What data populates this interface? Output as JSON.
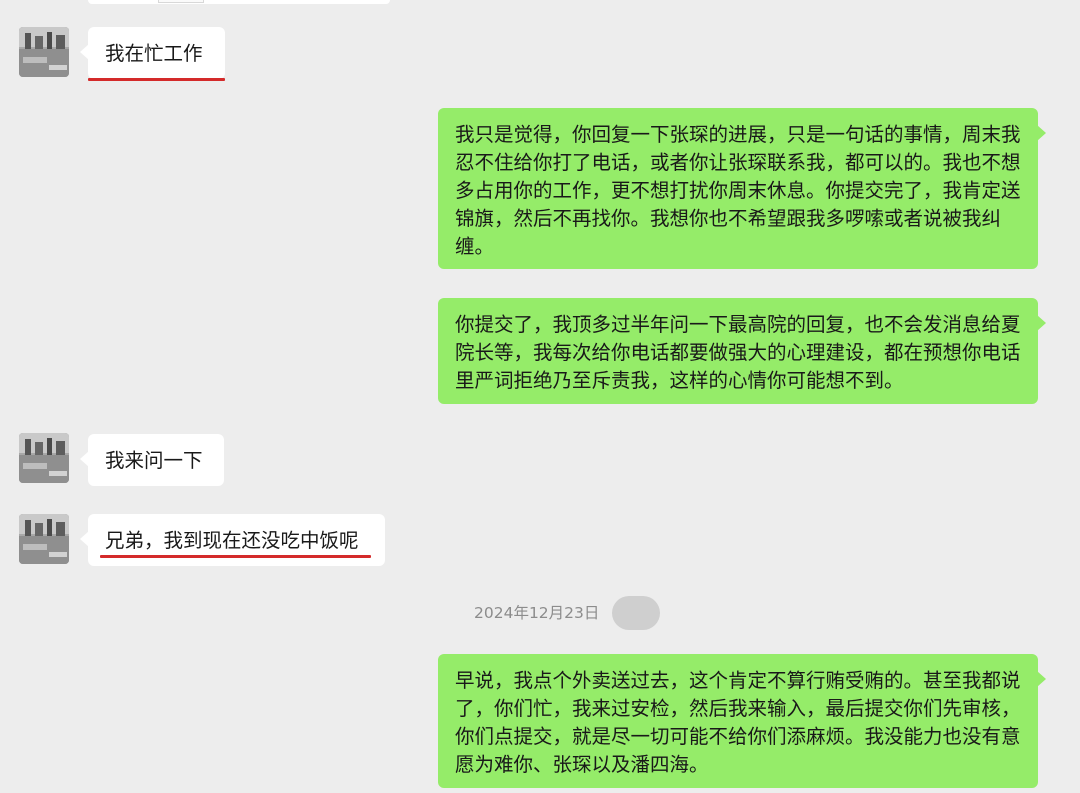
{
  "timestamp": "2024年12月23日",
  "colors": {
    "background": "#ededed",
    "incoming_bubble": "#ffffff",
    "outgoing_bubble": "#95ec69",
    "highlight_underline": "#d42a2a"
  },
  "messages": [
    {
      "side": "left",
      "text": "我在忙工作",
      "underlined": true
    },
    {
      "side": "right",
      "text": "我只是觉得，你回复一下张琛的进展，只是一句话的事情，周末我忍不住给你打了电话，或者你让张琛联系我，都可以的。我也不想多占用你的工作，更不想打扰你周末休息。你提交完了，我肯定送锦旗，然后不再找你。我想你也不希望跟我多啰嗦或者说被我纠缠。"
    },
    {
      "side": "right",
      "text": "你提交了，我顶多过半年问一下最高院的回复，也不会发消息给夏院长等，我每次给你电话都要做强大的心理建设，都在预想你电话里严词拒绝乃至斥责我，这样的心情你可能想不到。"
    },
    {
      "side": "left",
      "text": "我来问一下"
    },
    {
      "side": "left",
      "text": "兄弟，我到现在还没吃中饭呢",
      "underlined": true
    },
    {
      "side": "right",
      "text": "早说，我点个外卖送过去，这个肯定不算行贿受贿的。甚至我都说了，你们忙，我来过安检，然后我来输入，最后提交你们先审核，你们点提交，就是尽一切可能不给你们添麻烦。我没能力也没有意愿为难你、张琛以及潘四海。"
    }
  ]
}
